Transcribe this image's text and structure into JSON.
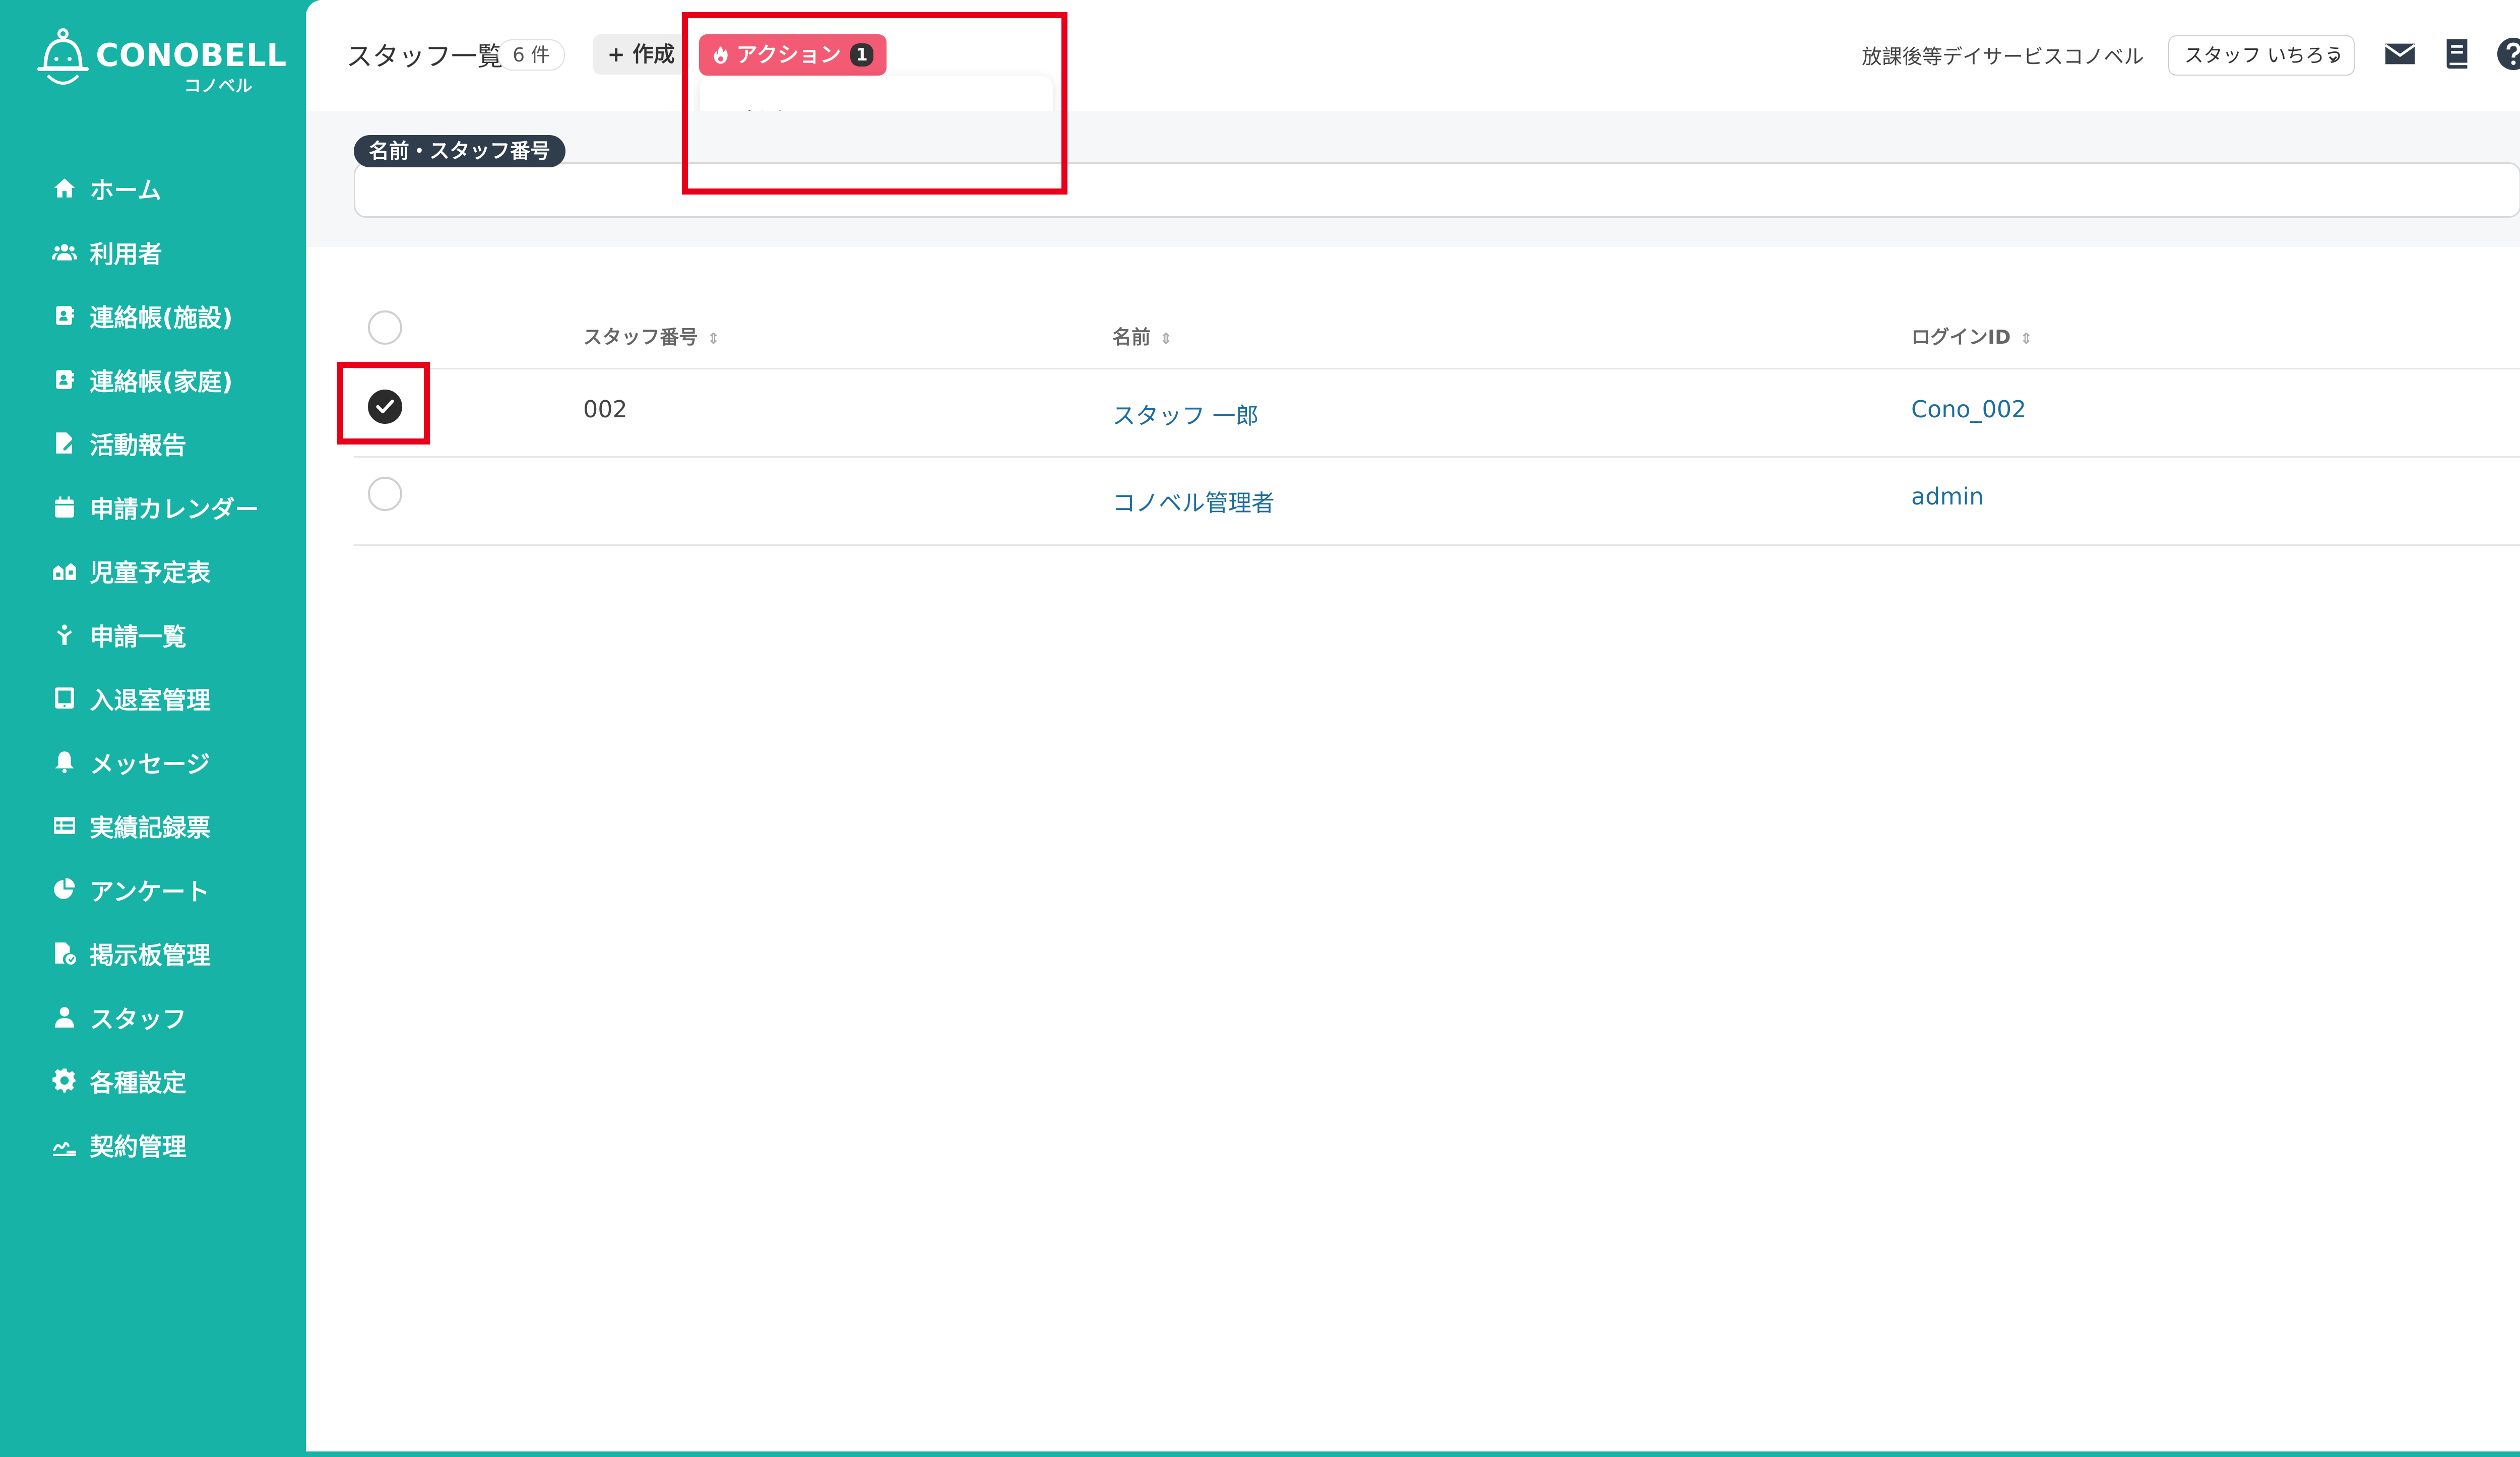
{
  "app": {
    "brand": "CONOBELL",
    "brand_sub": "コノベル"
  },
  "sidebar": {
    "items": [
      {
        "label": "ホーム",
        "icon": "home-icon"
      },
      {
        "label": "利用者",
        "icon": "users-icon"
      },
      {
        "label": "連絡帳(施設)",
        "icon": "contact-book-icon"
      },
      {
        "label": "連絡帳(家庭)",
        "icon": "contact-book-icon"
      },
      {
        "label": "活動報告",
        "icon": "report-icon"
      },
      {
        "label": "申請カレンダー",
        "icon": "calendar-icon"
      },
      {
        "label": "児童予定表",
        "icon": "children-schedule-icon"
      },
      {
        "label": "申請一覧",
        "icon": "application-list-icon"
      },
      {
        "label": "入退室管理",
        "icon": "tablet-icon"
      },
      {
        "label": "メッセージ",
        "icon": "bell-icon"
      },
      {
        "label": "実績記録票",
        "icon": "table-icon"
      },
      {
        "label": "アンケート",
        "icon": "pie-chart-icon"
      },
      {
        "label": "掲示板管理",
        "icon": "board-icon"
      },
      {
        "label": "スタッフ",
        "icon": "staff-icon"
      },
      {
        "label": "各種設定",
        "icon": "gear-icon"
      },
      {
        "label": "契約管理",
        "icon": "contract-icon"
      }
    ]
  },
  "header": {
    "title": "スタッフ一覧",
    "count": "6 件",
    "create_label": "+ 作成",
    "action_label": "アクション",
    "action_count": "1",
    "dropdown_items": [
      "削除"
    ],
    "facility": "放課後等デイサービス",
    "company": "コノベル",
    "user_select_value": "スタッフ いちろう"
  },
  "filter": {
    "label": "名前・スタッフ番号",
    "value": ""
  },
  "table": {
    "columns": [
      "スタッフ番号",
      "名前",
      "ログインID"
    ],
    "rows": [
      {
        "checked": true,
        "staff_no": "002",
        "name": "スタッフ 一郎",
        "login_id": "Cono_002"
      },
      {
        "checked": false,
        "staff_no": "",
        "name": "コノベル管理者",
        "login_id": "admin"
      }
    ]
  },
  "colors": {
    "brand": "#16b3a6",
    "action": "#f25b73",
    "link": "#1c6ea0",
    "highlight": "#e8001a"
  }
}
